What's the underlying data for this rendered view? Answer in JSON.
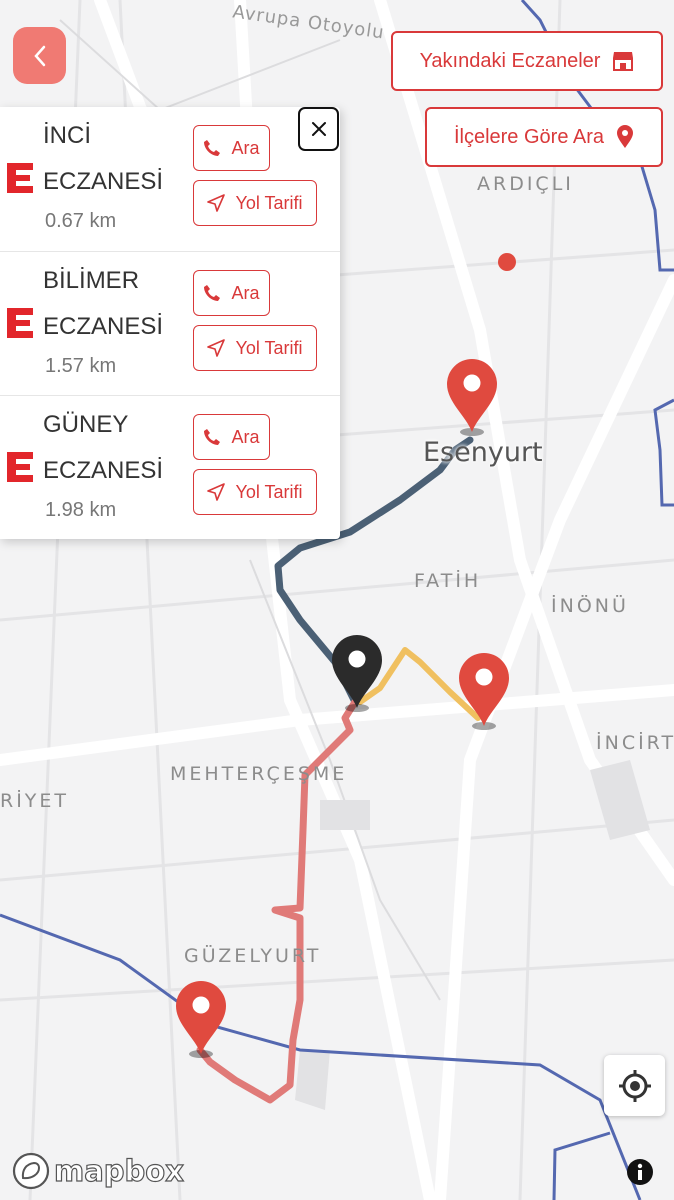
{
  "header": {
    "back_icon": "chevron-left-icon",
    "nearby_label": "Yakındaki Eczaneler",
    "nearby_icon": "store-icon",
    "district_label": "İlçelere Göre Ara",
    "district_icon": "map-pin-icon"
  },
  "panel": {
    "close_icon": "close-icon",
    "pharmacies": [
      {
        "name": "İNCİ ECZANESİ",
        "distance": "0.67 km",
        "call_label": "Ara",
        "directions_label": "Yol Tarifi"
      },
      {
        "name": "BİLİMER ECZANESİ",
        "distance": "1.57 km",
        "call_label": "Ara",
        "directions_label": "Yol Tarifi"
      },
      {
        "name": "GÜNEY ECZANESİ",
        "distance": "1.98 km",
        "call_label": "Ara",
        "directions_label": "Yol Tarifi"
      }
    ]
  },
  "map": {
    "road_label": "Avrupa Otoyolu",
    "city": "Esenyurt",
    "neighborhoods": [
      "ARDIÇLI",
      "FATİH",
      "İNÖNÜ",
      "İNCİRT",
      "MEHTERÇEŞME",
      "RİYET",
      "GÜZELYURT"
    ],
    "colors": {
      "route_to_esenyurt": "#4b6075",
      "route_orange": "#f0c060",
      "route_pink": "#e07a78",
      "boundary": "#5468b0",
      "pin": "#e04a3f",
      "user_pin": "#2b2b2b"
    }
  },
  "controls": {
    "locate_icon": "locate-crosshair-icon",
    "attribution_text": "mapbox",
    "info_icon": "info-icon"
  },
  "theme": {
    "accent": "#d9393a"
  }
}
